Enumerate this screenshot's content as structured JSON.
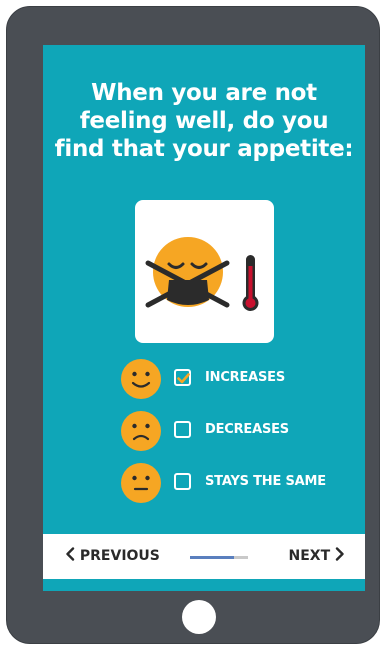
{
  "question": {
    "line1": "When you are not",
    "line2": "feeling well, do you",
    "line3": "find that your appetite:"
  },
  "illustration": {
    "face_icon": "sick-face-with-mask-icon",
    "thermometer_icon": "thermometer-icon"
  },
  "options": [
    {
      "label": "INCREASES",
      "checked": true,
      "emoji": "smiling-face-icon"
    },
    {
      "label": "DECREASES",
      "checked": false,
      "emoji": "frowning-face-icon"
    },
    {
      "label": "STAYS THE SAME",
      "checked": false,
      "emoji": "neutral-face-icon"
    }
  ],
  "nav": {
    "previous_label": "PREVIOUS",
    "next_label": "NEXT",
    "progress": 0.75
  },
  "colors": {
    "screen_bg": "#0fa6b8",
    "device": "#4a4e54",
    "emoji_yellow": "#f6a623",
    "checkmark": "#f6a623",
    "progress": "#5a7fbe",
    "thermometer": "#c8102e"
  }
}
